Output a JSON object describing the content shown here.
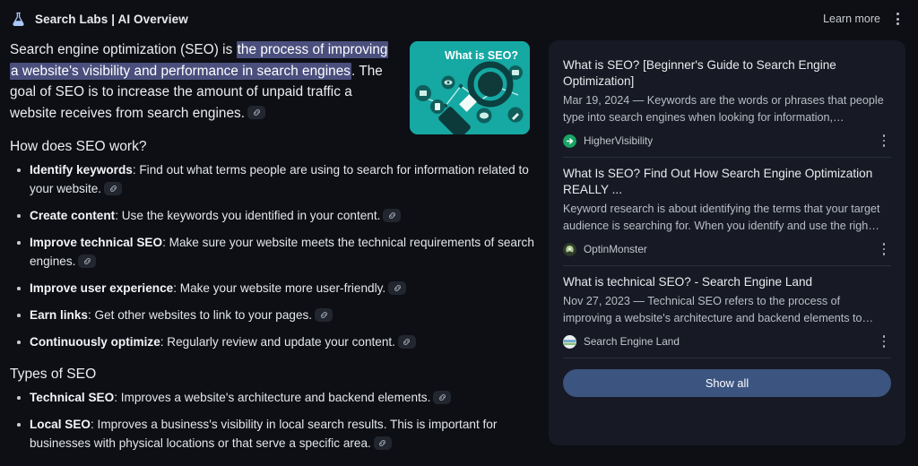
{
  "header": {
    "brand_icon": "flask-icon",
    "brand_title": "Search Labs | AI Overview",
    "learn_more_label": "Learn more",
    "more_options_icon": "kebab-menu-icon"
  },
  "colors": {
    "page_background": "#0d0f14",
    "panel_background": "#171a24",
    "highlight_background": "#4a4f7d",
    "accent_button": "#3c5480",
    "thumbnail_background": "#1ba8a0",
    "text_primary": "#eceef1",
    "text_secondary": "#b9bdc6",
    "divider": "#2a2e3a"
  },
  "overview": {
    "intro": {
      "before_highlight": "Search engine optimization (SEO) is ",
      "highlight": "the process of improving a website's visibility and performance in search engines",
      "after_highlight": ". The goal of SEO is to increase the amount of unpaid traffic a website receives from search engines.",
      "citation_icon": "link-icon"
    },
    "thumbnail": {
      "alt": "What is SEO? infographic",
      "caption_text": "What is SEO?"
    },
    "sections": [
      {
        "heading": "How does SEO work?",
        "items": [
          {
            "term": "Identify keywords",
            "text": ": Find out what terms people are using to search for information related to your website.",
            "citation_icon": "link-icon"
          },
          {
            "term": "Create content",
            "text": ": Use the keywords you identified in your content.",
            "citation_icon": "link-icon"
          },
          {
            "term": "Improve technical SEO",
            "text": ": Make sure your website meets the technical requirements of search engines.",
            "citation_icon": "link-icon"
          },
          {
            "term": "Improve user experience",
            "text": ": Make your website more user-friendly.",
            "citation_icon": "link-icon"
          },
          {
            "term": "Earn links",
            "text": ": Get other websites to link to your pages.",
            "citation_icon": "link-icon"
          },
          {
            "term": "Continuously optimize",
            "text": ": Regularly review and update your content.",
            "citation_icon": "link-icon"
          }
        ]
      },
      {
        "heading": "Types of SEO",
        "items": [
          {
            "term": "Technical SEO",
            "text": ": Improves a website's architecture and backend elements.",
            "citation_icon": "link-icon"
          },
          {
            "term": "Local SEO",
            "text": ": Improves a business's visibility in local search results. This is important for businesses with physical locations or that serve a specific area.",
            "citation_icon": "link-icon"
          }
        ]
      }
    ]
  },
  "sources_panel": {
    "results": [
      {
        "title": "What is SEO? [Beginner's Guide to Search Engine Optimization]",
        "snippet": "Mar 19, 2024 — Keywords are the words or phrases that people type into search engines when looking for information,…",
        "source": "HigherVisibility",
        "favicon_color": "#1aa564",
        "favicon_icon": "arrow-circle-icon",
        "more_options_icon": "kebab-menu-icon"
      },
      {
        "title": "What Is SEO? Find Out How Search Engine Optimization REALLY ...",
        "snippet": "Keyword research is about identifying the terms that your target audience is searching for. When you identify and use the righ…",
        "source": "OptinMonster",
        "favicon_color": "#8aa86b",
        "favicon_icon": "monster-circle-icon",
        "more_options_icon": "kebab-menu-icon"
      },
      {
        "title": "What is technical SEO? - Search Engine Land",
        "snippet": "Nov 27, 2023 — Technical SEO refers to the process of improving a website's architecture and backend elements to…",
        "source": "Search Engine Land",
        "favicon_color": "#6fa8c9",
        "favicon_icon": "globe-circle-icon",
        "more_options_icon": "kebab-menu-icon"
      }
    ],
    "show_all_label": "Show all"
  }
}
